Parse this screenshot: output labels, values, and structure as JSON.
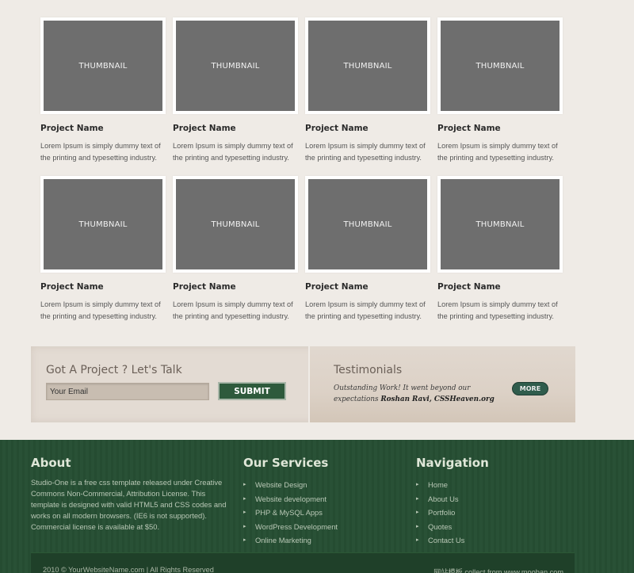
{
  "projects": [
    {
      "thumb_label": "THUMBNAIL",
      "name": "Project Name",
      "description": "Lorem Ipsum is simply dummy text of the printing and typesetting industry."
    },
    {
      "thumb_label": "THUMBNAIL",
      "name": "Project Name",
      "description": "Lorem Ipsum is simply dummy text of the printing and typesetting industry."
    },
    {
      "thumb_label": "THUMBNAIL",
      "name": "Project Name",
      "description": "Lorem Ipsum is simply dummy text of the printing and typesetting industry."
    },
    {
      "thumb_label": "THUMBNAIL",
      "name": "Project Name",
      "description": "Lorem Ipsum is simply dummy text of the printing and typesetting industry."
    },
    {
      "thumb_label": "THUMBNAIL",
      "name": "Project Name",
      "description": "Lorem Ipsum is simply dummy text of the printing and typesetting industry."
    },
    {
      "thumb_label": "THUMBNAIL",
      "name": "Project Name",
      "description": "Lorem Ipsum is simply dummy text of the printing and typesetting industry."
    },
    {
      "thumb_label": "THUMBNAIL",
      "name": "Project Name",
      "description": "Lorem Ipsum is simply dummy text of the printing and typesetting industry."
    },
    {
      "thumb_label": "THUMBNAIL",
      "name": "Project Name",
      "description": "Lorem Ipsum is simply dummy text of the printing and typesetting industry."
    }
  ],
  "contact": {
    "title": "Got A Project ? Let's Talk",
    "email_placeholder": "Your Email",
    "submit_label": "SUBMIT"
  },
  "testimonials": {
    "title": "Testimonials",
    "quote": "Outstanding Work! It went beyond our expectations",
    "author": "Roshan Ravi, CSSHeaven.org",
    "more_label": "MORE"
  },
  "footer": {
    "about": {
      "title": "About",
      "text": "Studio-One is a free css template released under Creative Commons Non-Commercial, Attribution License. This template is designed with valid HTML5 and CSS codes and works on all modern browsers. (IE6 is not supported). Commercial license is available at $50."
    },
    "services": {
      "title": "Our Services",
      "items": [
        "Website Design",
        "Website development",
        "PHP & MySQL Apps",
        "WordPress Development",
        "Online Marketing"
      ]
    },
    "navigation": {
      "title": "Navigation",
      "items": [
        "Home",
        "About Us",
        "Portfolio",
        "Quotes",
        "Contact Us"
      ]
    },
    "copyright": "2010 © YourWebsiteName.com | All Rights Reserved",
    "credit": "网站模板 collect from www.mooban.com"
  },
  "icons": {
    "bullet": "▸"
  },
  "colors": {
    "page_bg": "#efebe6",
    "footer_bg": "#264e33",
    "submit_bg": "#2e5a3c",
    "thumb_gray": "#6e6e6e"
  }
}
